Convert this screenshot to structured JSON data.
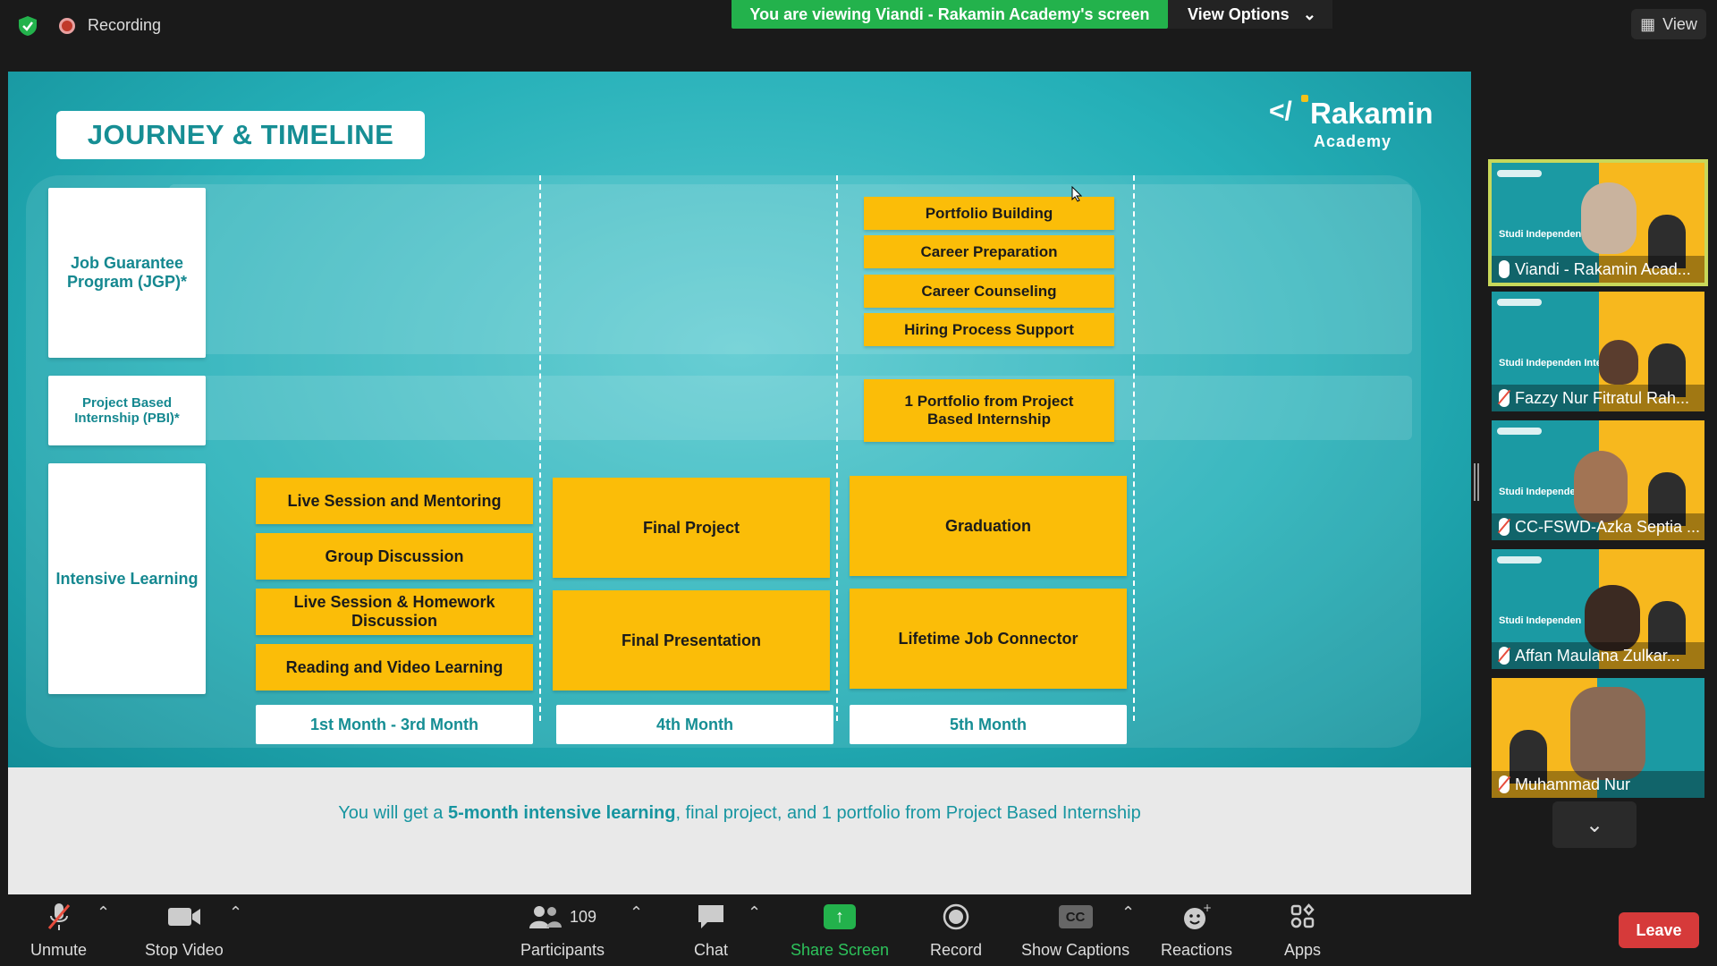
{
  "topbar": {
    "recording_label": "Recording",
    "viewing_banner": "You are viewing Viandi - Rakamin Academy's screen",
    "view_options_label": "View Options",
    "view_label": "View"
  },
  "slide": {
    "title": "JOURNEY & TIMELINE",
    "logo_name": "Rakamin",
    "logo_sub": "Academy",
    "rows": {
      "jgp": "Job Guarantee Program (JGP)*",
      "pbi": "Project Based Internship (PBI)*",
      "intensive": "Intensive Learning"
    },
    "jgp_items": [
      "Portfolio Building",
      "Career Preparation",
      "Career Counseling",
      "Hiring Process Support"
    ],
    "pbi_item": "1 Portfolio from Project Based Internship",
    "learning_col1": [
      "Live Session and Mentoring",
      "Group Discussion",
      "Live Session & Homework Discussion",
      "Reading and Video Learning"
    ],
    "learning_col2": [
      "Final Project",
      "Final Presentation"
    ],
    "learning_col3": [
      "Graduation",
      "Lifetime Job Connector"
    ],
    "months": [
      "1st Month - 3rd Month",
      "4th Month",
      "5th Month"
    ],
    "caption_pre": "You will get a ",
    "caption_bold": "5-month intensive learning",
    "caption_post": ", final project, and 1 portfolio from Project Based Internship"
  },
  "gallery": {
    "tile_text": "Studi Independen Intensive",
    "participants": [
      {
        "name": "Viandi - Rakamin Acad..."
      },
      {
        "name": "Fazzy Nur Fitratul Rah..."
      },
      {
        "name": "CC-FSWD-Azka Septia ..."
      },
      {
        "name": "Affan Maulana Zulkar..."
      },
      {
        "name": "Muhammad Nur"
      }
    ]
  },
  "toolbar": {
    "unmute": "Unmute",
    "stop_video": "Stop Video",
    "participants": "Participants",
    "participants_count": "109",
    "chat": "Chat",
    "share_screen": "Share Screen",
    "record": "Record",
    "show_captions": "Show Captions",
    "reactions": "Reactions",
    "apps": "Apps",
    "leave": "Leave",
    "cc": "CC"
  },
  "colors": {
    "accent_green": "#23b24c",
    "slide_teal": "#1aa8b0",
    "box_yellow": "#fbbd08",
    "leave_red": "#d63a3a"
  }
}
